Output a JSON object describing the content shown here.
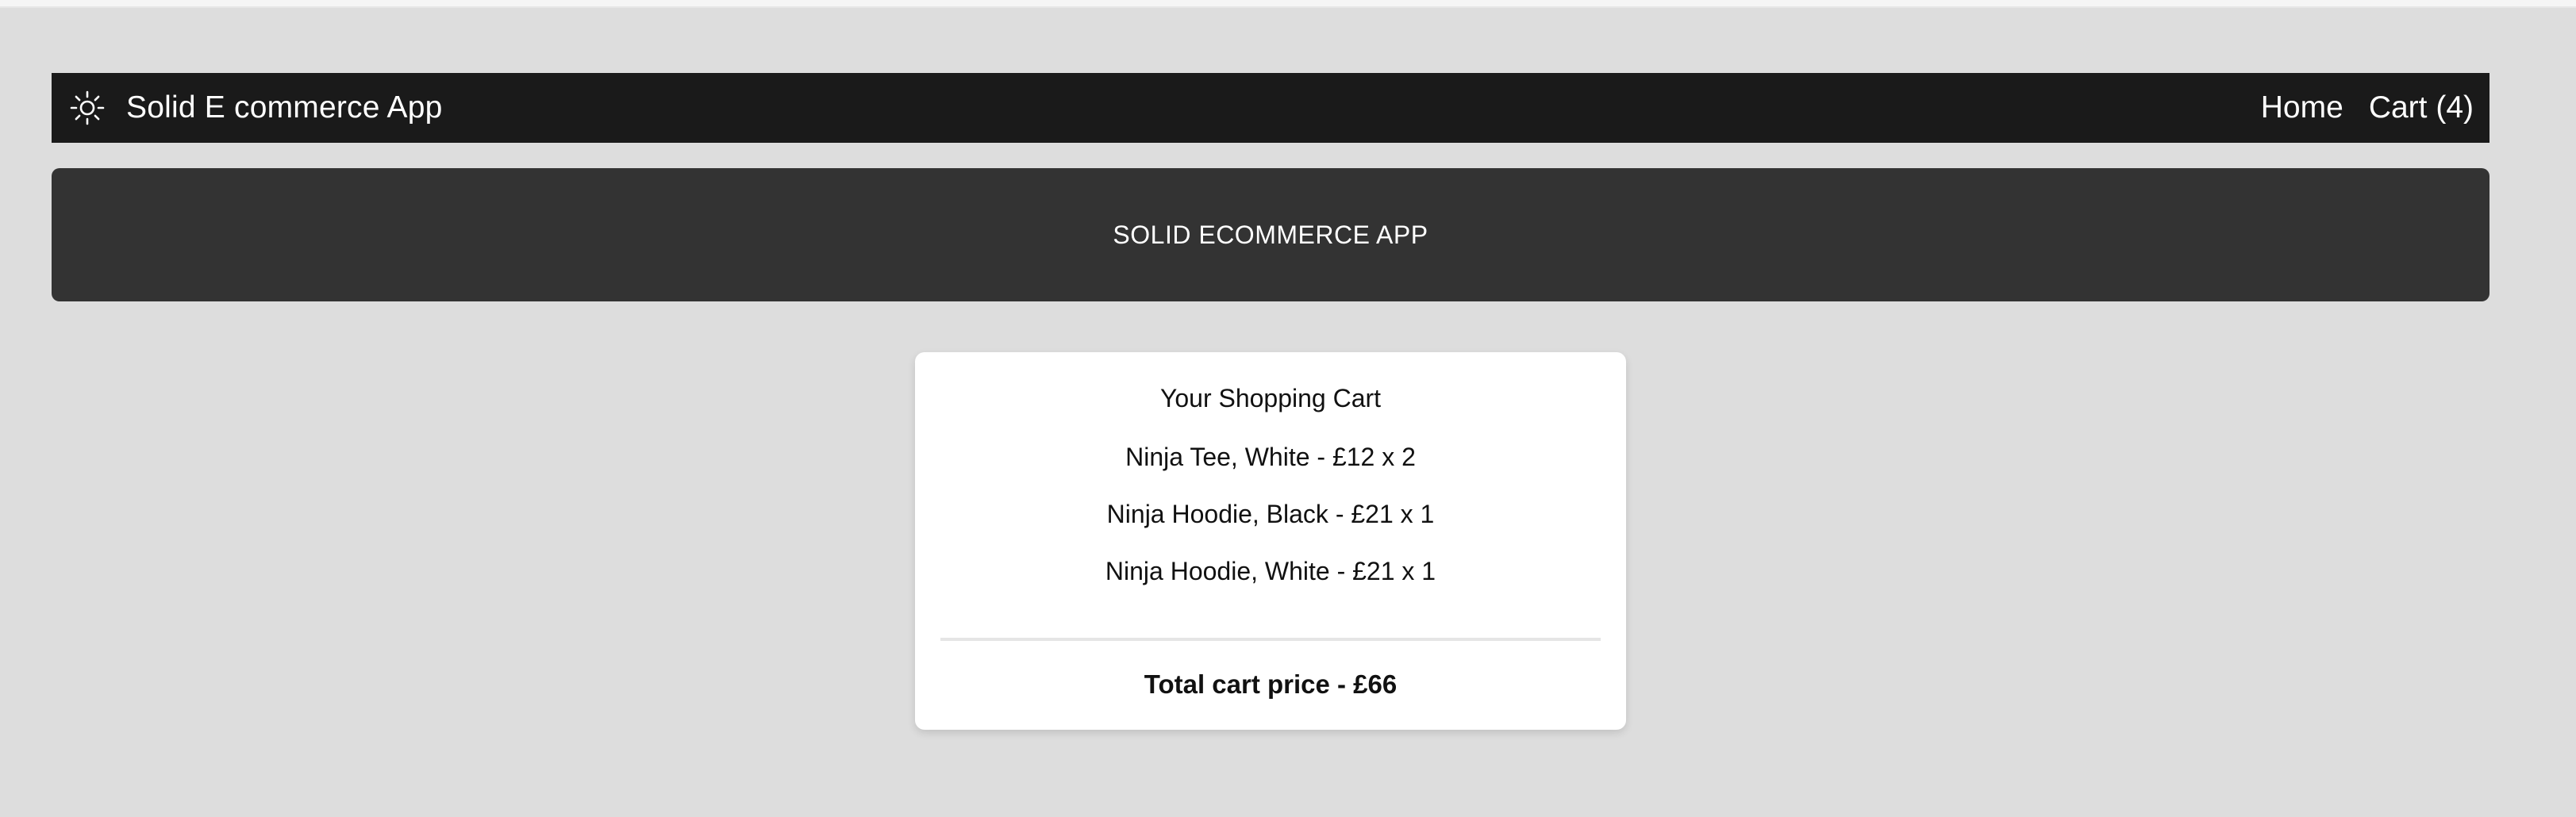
{
  "navbar": {
    "theme_icon": "sun-icon",
    "brand": "Solid E commerce App",
    "links": [
      {
        "label": "Home"
      },
      {
        "label": "Cart (4)"
      }
    ]
  },
  "banner": {
    "title": "SOLID ECOMMERCE APP"
  },
  "cart": {
    "title": "Your Shopping Cart",
    "items": [
      {
        "text": "Ninja Tee, White - £12 x 2"
      },
      {
        "text": "Ninja Hoodie, Black - £21 x 1"
      },
      {
        "text": "Ninja Hoodie, White - £21 x 1"
      }
    ],
    "total": "Total cart price - £66"
  },
  "colors": {
    "background": "#dddddd",
    "navbar": "#1a1a1a",
    "banner": "#333333",
    "card": "#ffffff"
  }
}
